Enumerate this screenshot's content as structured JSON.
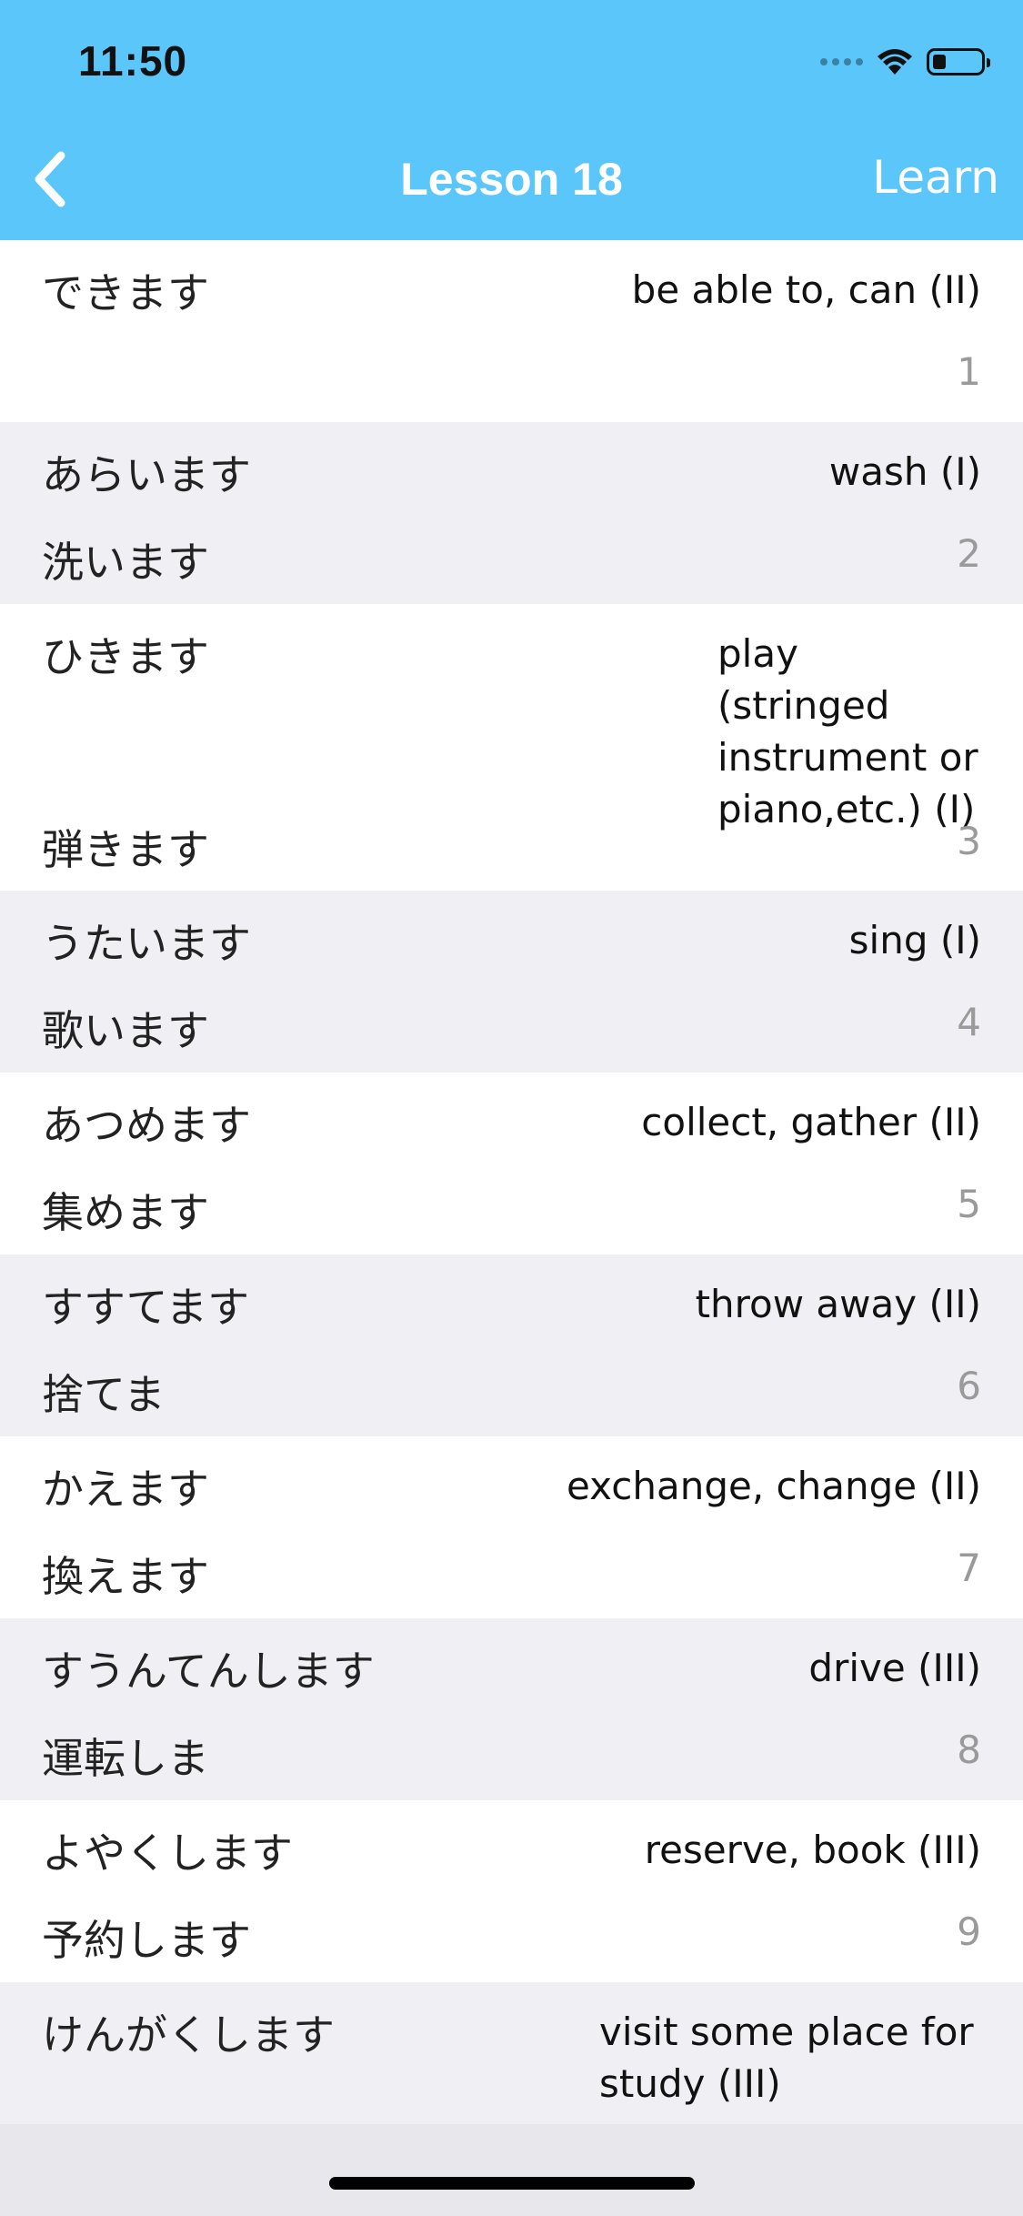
{
  "status_bar": {
    "time": "11:50",
    "icons": [
      "signal-dots-icon",
      "wifi-icon",
      "battery-icon"
    ]
  },
  "nav": {
    "back_icon": "chevron-left-icon",
    "title": "Lesson 18",
    "action_label": "Learn"
  },
  "colors": {
    "header": "#5bc6fa",
    "row_alt": "#efeff4",
    "number_text": "#9a9a9a"
  },
  "items": [
    {
      "kana": "できます",
      "kanji": "",
      "meaning": "be able to, can (II)",
      "number": "1"
    },
    {
      "kana": "あらいます",
      "kanji": "洗います",
      "meaning": "wash (I)",
      "number": "2"
    },
    {
      "kana": "ひきます",
      "kanji": "弾きます",
      "meaning": "play (stringed instrument or piano,etc.) (I)",
      "number": "3"
    },
    {
      "kana": "うたいます",
      "kanji": "歌います",
      "meaning": "sing (I)",
      "number": "4"
    },
    {
      "kana": "あつめます",
      "kanji": "集めます",
      "meaning": "collect, gather (II)",
      "number": "5"
    },
    {
      "kana": "すすてます",
      "kanji": "捨てま",
      "meaning": "throw away (II)",
      "number": "6"
    },
    {
      "kana": "かえます",
      "kanji": "換えます",
      "meaning": "exchange, change (II)",
      "number": "7"
    },
    {
      "kana": "すうんてんします",
      "kanji": "運転しま",
      "meaning": "drive (III)",
      "number": "8"
    },
    {
      "kana": "よやくします",
      "kanji": "予約します",
      "meaning": "reserve, book (III)",
      "number": "9"
    },
    {
      "kana": "けんがくします",
      "kanji": "",
      "meaning": "visit some place for study (III)",
      "number": ""
    }
  ]
}
